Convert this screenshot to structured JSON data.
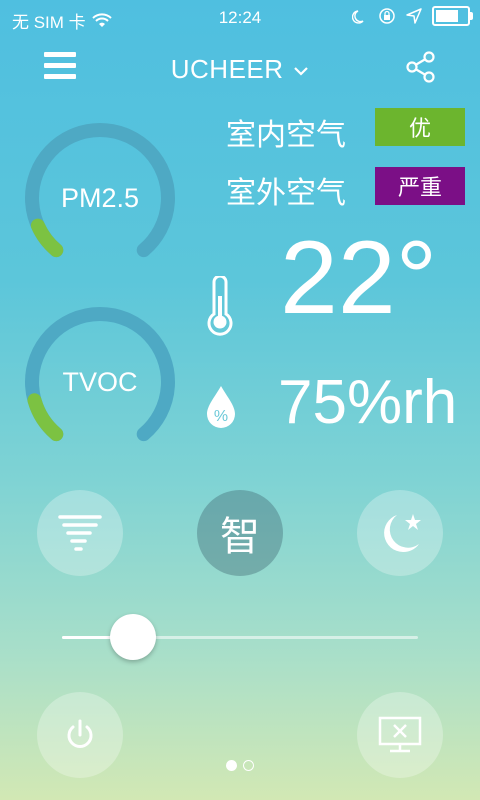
{
  "status_bar": {
    "carrier": "无 SIM 卡",
    "time": "12:24",
    "battery_level": 0.85,
    "icons": [
      "wifi-icon",
      "moon-icon",
      "rotation-lock-icon",
      "location-arrow-icon",
      "battery-icon"
    ]
  },
  "header": {
    "title": "UCHEER",
    "menu_icon": "hamburger-menu-icon",
    "dropdown_icon": "chevron-down-icon",
    "share_icon": "share-icon"
  },
  "gauges": [
    {
      "label": "PM2.5",
      "level": 0.05,
      "track_color": "#4ea9c4",
      "value_color": "#7cc242"
    },
    {
      "label": "TVOC",
      "level": 0.08,
      "track_color": "#4ea9c4",
      "value_color": "#7cc242"
    }
  ],
  "air_quality": {
    "indoor": {
      "label": "室内空气",
      "status": "优",
      "color": "#6cb52e"
    },
    "outdoor": {
      "label": "室外空气",
      "status": "严重",
      "color": "#7b0f86"
    }
  },
  "readings": {
    "temperature": "22°",
    "humidity": "75%rh",
    "temperature_icon": "thermometer-icon",
    "humidity_icon": "water-drop-icon"
  },
  "modes": {
    "turbo_icon": "tornado-icon",
    "smart_label": "智",
    "sleep_icon": "moon-star-icon"
  },
  "slider": {
    "level": 0.12
  },
  "bottom": {
    "power_icon": "power-icon",
    "screen_off_icon": "screen-off-icon"
  },
  "pager": {
    "pages": 2,
    "current": 1
  }
}
